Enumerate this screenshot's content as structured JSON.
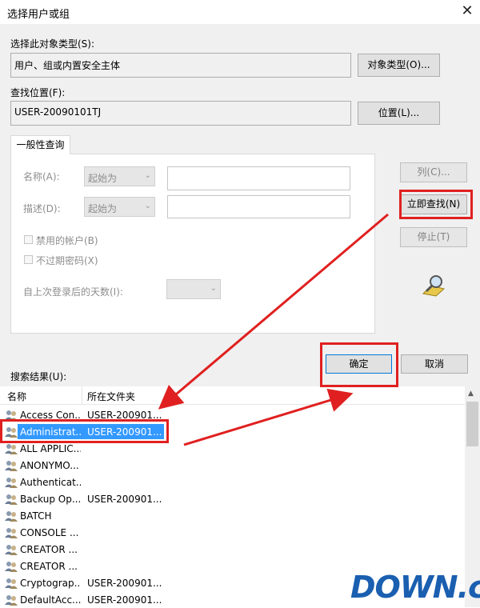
{
  "window": {
    "title": "选择用户或组",
    "close_glyph": "✕"
  },
  "object_type": {
    "label": "选择此对象类型(S):",
    "value": "用户、组或内置安全主体",
    "button": "对象类型(O)..."
  },
  "location": {
    "label": "查找位置(F):",
    "value": "USER-20090101TJ",
    "button": "位置(L)..."
  },
  "query_tab": {
    "label": "一般性查询"
  },
  "query": {
    "name_label": "名称(A):",
    "name_mode": "起始为",
    "desc_label": "描述(D):",
    "desc_mode": "起始为",
    "disabled_accounts": "禁用的帐户(B)",
    "non_expiring_pw": "不过期密码(X)",
    "days_label": "自上次登录后的天数(I):"
  },
  "side_buttons": {
    "columns": "列(C)...",
    "find_now": "立即查找(N)",
    "stop": "停止(T)"
  },
  "dialog_buttons": {
    "ok": "确定",
    "cancel": "取消"
  },
  "results": {
    "label": "搜索结果(U):",
    "columns": [
      "名称",
      "所在文件夹"
    ],
    "rows": [
      {
        "name": "Access Con...",
        "folder": "USER-200901..."
      },
      {
        "name": "Administrat...",
        "folder": "USER-200901..."
      },
      {
        "name": "ALL APPLIC...",
        "folder": ""
      },
      {
        "name": "ANONYMO...",
        "folder": ""
      },
      {
        "name": "Authenticat...",
        "folder": ""
      },
      {
        "name": "Backup Op...",
        "folder": "USER-200901..."
      },
      {
        "name": "BATCH",
        "folder": ""
      },
      {
        "name": "CONSOLE ...",
        "folder": ""
      },
      {
        "name": "CREATOR ...",
        "folder": ""
      },
      {
        "name": "CREATOR ...",
        "folder": ""
      },
      {
        "name": "Cryptograp...",
        "folder": "USER-200901..."
      },
      {
        "name": "DefaultAcc...",
        "folder": "USER-200901..."
      }
    ],
    "selected_index": 1
  },
  "watermark": {
    "text": "DOWN",
    "suffix": ".cc"
  },
  "colors": {
    "selection": "#3399ff",
    "annotation": "#e02020"
  }
}
